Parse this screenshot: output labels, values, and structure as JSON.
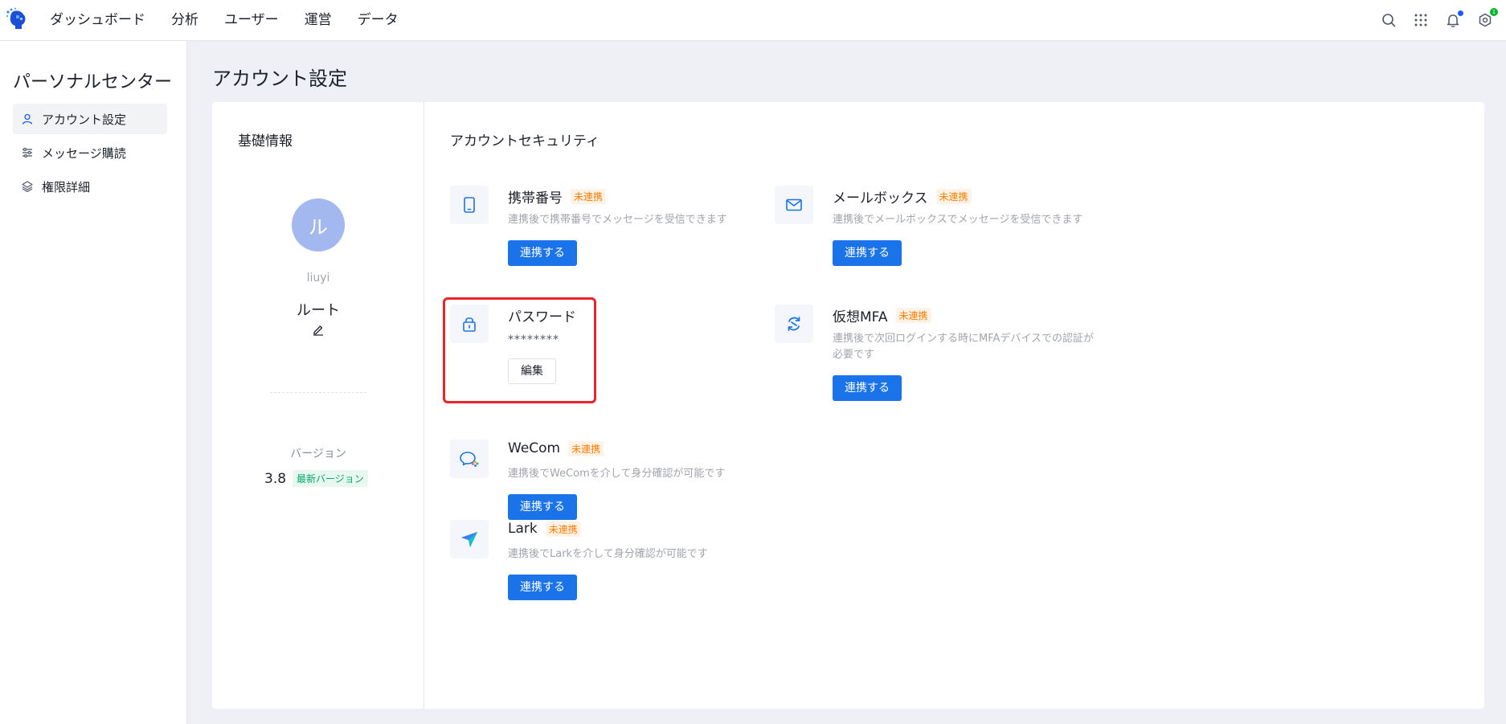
{
  "topbar": {
    "nav": [
      "ダッシュボード",
      "分析",
      "ユーザー",
      "運営",
      "データ"
    ],
    "icons": [
      "search-icon",
      "apps-grid-icon",
      "bell-icon",
      "settings-icon"
    ],
    "settings_badge": "1",
    "accent": "#165dff"
  },
  "sidebar": {
    "title": "パーソナルセンター",
    "items": [
      {
        "label": "アカウント設定",
        "icon": "user-icon",
        "active": true
      },
      {
        "label": "メッセージ購読",
        "icon": "sliders-icon",
        "active": false
      },
      {
        "label": "権限詳細",
        "icon": "layers-icon",
        "active": false
      }
    ]
  },
  "page": {
    "title": "アカウント設定"
  },
  "basic": {
    "title": "基礎情報",
    "avatar_char": "ル",
    "avatar_color": "#a3b8ef",
    "username": "liuyi",
    "role": "ルート",
    "version_label": "バージョン",
    "version": "3.8",
    "version_tag": "最新バージョン"
  },
  "security": {
    "title": "アカウントセキュリティ",
    "items": [
      {
        "title": "携帯番号",
        "tag": "未連携",
        "desc": "連携後で携帯番号でメッセージを受信できます",
        "button": "連携する",
        "icon": "phone-icon"
      },
      {
        "title": "メールボックス",
        "tag": "未連携",
        "desc": "連携後でメールボックスでメッセージを受信できます",
        "button": "連携する",
        "icon": "mail-icon"
      },
      {
        "title": "パスワード",
        "value": "********",
        "button": "編集",
        "icon": "lock-icon"
      },
      {
        "title": "仮想MFA",
        "tag": "未連携",
        "desc_line1": "連携後で次回ログインする時にMFAデバイスでの認証が",
        "desc_line2": "必要です",
        "button": "連携する",
        "icon": "mfa-sync-icon"
      },
      {
        "title": "WeCom",
        "tag": "未連携",
        "desc": "連携後でWeComを介して身分確認が可能です",
        "button": "連携する",
        "icon": "wecom-icon"
      },
      {
        "title": "Lark",
        "tag": "未連携",
        "desc": "連携後でLarkを介して身分確認が可能です",
        "button": "連携する",
        "icon": "lark-icon"
      }
    ],
    "primary_color": "#1a73e8",
    "tag_color": "#ff7d00",
    "highlight_color": "#e8262a"
  }
}
